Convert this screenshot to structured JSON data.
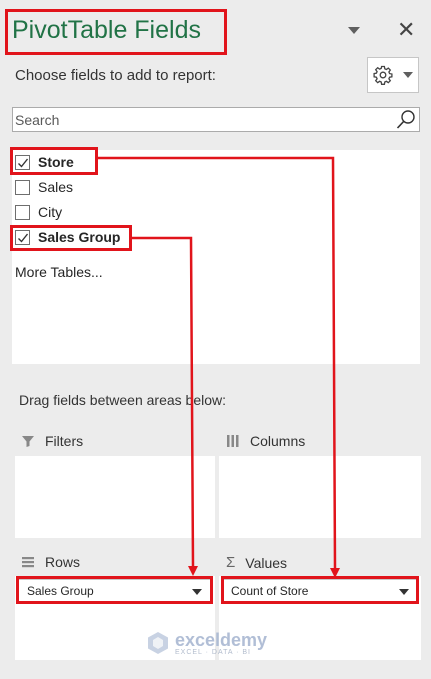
{
  "header": {
    "title": "PivotTable Fields",
    "close_glyph": "✕"
  },
  "chooser": {
    "subtitle": "Choose fields to add to report:",
    "settings_icon": "gear-icon"
  },
  "search": {
    "placeholder": "Search"
  },
  "fields": [
    {
      "label": "Store",
      "checked": true
    },
    {
      "label": "Sales",
      "checked": false
    },
    {
      "label": "City",
      "checked": false
    },
    {
      "label": "Sales Group",
      "checked": true
    }
  ],
  "more_tables": "More Tables...",
  "drag_label": "Drag fields between areas below:",
  "areas": {
    "filters": {
      "label": "Filters"
    },
    "columns": {
      "label": "Columns"
    },
    "rows": {
      "label": "Rows",
      "item": "Sales Group"
    },
    "values": {
      "label": "Values",
      "item": "Count of Store"
    }
  },
  "watermark": {
    "name": "exceldemy",
    "tagline": "EXCEL · DATA · BI"
  },
  "colors": {
    "title": "#217346",
    "highlight": "#e1141b",
    "panel_bg": "#ececec"
  }
}
